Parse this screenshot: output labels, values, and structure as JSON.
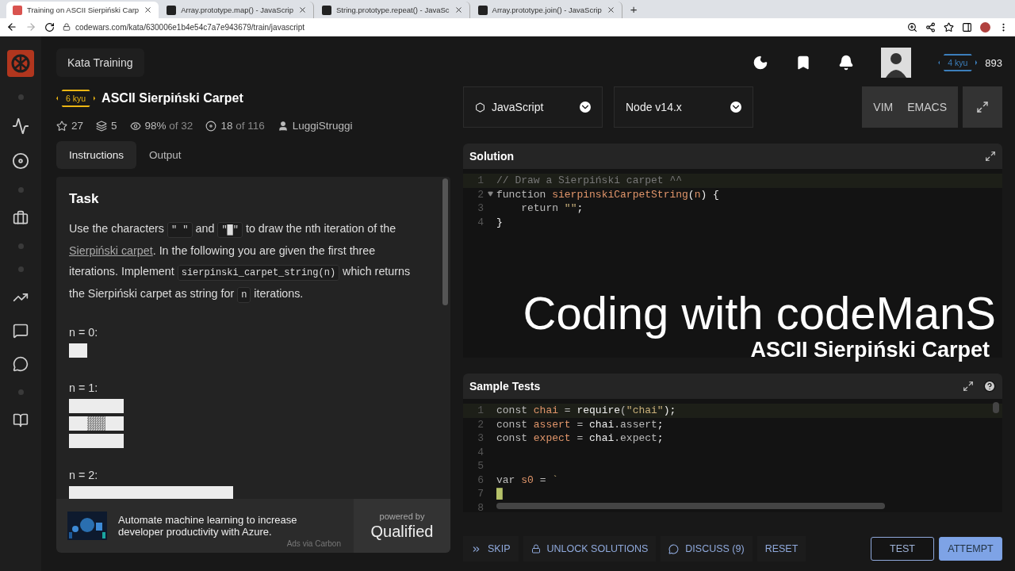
{
  "browser": {
    "tabs": [
      {
        "title": "Training on ASCII Sierpiński Carp",
        "selected": true
      },
      {
        "title": "Array.prototype.map() - JavaScrip",
        "selected": false
      },
      {
        "title": "String.prototype.repeat() - JavaSc",
        "selected": false
      },
      {
        "title": "Array.prototype.join() - JavaScrip",
        "selected": false
      }
    ],
    "new_tab": "+",
    "url": "codewars.com/kata/630006e1b4e54c7a7e943679/train/javascript"
  },
  "header": {
    "title": "Kata Training",
    "rank": "4 kyu",
    "honor": "893"
  },
  "kata": {
    "rank": "6 kyu",
    "title": "ASCII Sierpiński Carpet",
    "stars": "27",
    "collections": "5",
    "satisfaction": "98%",
    "satisfaction_of": "of 32",
    "completed": "18",
    "completed_of": "of 116",
    "author": "LuggiStruggi"
  },
  "tabs": [
    {
      "label": "Instructions",
      "selected": true
    },
    {
      "label": "Output",
      "selected": false
    }
  ],
  "description": {
    "heading": "Task",
    "paragraph": [
      {
        "kind": "text",
        "text": "Use the characters "
      },
      {
        "kind": "code",
        "text": "\" \""
      },
      {
        "kind": "text",
        "text": " and "
      },
      {
        "kind": "code",
        "text": "\"█\""
      },
      {
        "kind": "text",
        "text": " to draw the nth iteration of the "
      },
      {
        "kind": "link",
        "text": "Sierpiński carpet"
      },
      {
        "kind": "text",
        "text": ". In the following you are given the first three iterations. Implement "
      },
      {
        "kind": "code",
        "text": "sierpinski_carpet_string(n)"
      },
      {
        "kind": "text",
        "text": " which returns the Sierpiński carpet as string for "
      },
      {
        "kind": "code",
        "text": "n"
      },
      {
        "kind": "text",
        "text": " iterations."
      }
    ],
    "examples": [
      {
        "label": "n = 0:"
      },
      {
        "label": "n = 1:"
      },
      {
        "label": "n = 2:"
      }
    ]
  },
  "ad": {
    "text": "Automate machine learning to increase developer productivity with Azure.",
    "source": "Ads via Carbon",
    "powered_by": "powered by",
    "brand": "Qualified"
  },
  "editor": {
    "language": "JavaScript",
    "version": "Node v14.x",
    "modes": [
      "VIM",
      "EMACS"
    ],
    "solution": {
      "title": "Solution",
      "lines": [
        {
          "number": "1",
          "fold": false,
          "tokens": [
            {
              "kind": "comment",
              "text": "// Draw a Sierpiński carpet ^^"
            }
          ]
        },
        {
          "number": "2",
          "fold": true,
          "tokens": [
            {
              "kind": "keyword",
              "text": "function "
            },
            {
              "kind": "name",
              "text": "sierpinskiCarpetString"
            },
            {
              "kind": "plain",
              "text": "("
            },
            {
              "kind": "name",
              "text": "n"
            },
            {
              "kind": "plain",
              "text": ") {"
            }
          ]
        },
        {
          "number": "3",
          "fold": false,
          "tokens": [
            {
              "kind": "keyword",
              "text": "    return "
            },
            {
              "kind": "string",
              "text": "\"\""
            },
            {
              "kind": "plain",
              "text": ";"
            }
          ]
        },
        {
          "number": "4",
          "fold": false,
          "tokens": [
            {
              "kind": "plain",
              "text": "}"
            }
          ]
        }
      ]
    },
    "tests": {
      "title": "Sample Tests",
      "lines": [
        {
          "number": "1",
          "fold": false,
          "tokens": [
            {
              "kind": "keyword",
              "text": "const "
            },
            {
              "kind": "name",
              "text": "chai"
            },
            {
              "kind": "keyword",
              "text": " = "
            },
            {
              "kind": "plain",
              "text": "require"
            },
            {
              "kind": "keyword",
              "text": "("
            },
            {
              "kind": "string",
              "text": "\"chai\""
            },
            {
              "kind": "plain",
              "text": ");"
            }
          ]
        },
        {
          "number": "2",
          "fold": false,
          "tokens": [
            {
              "kind": "keyword",
              "text": "const "
            },
            {
              "kind": "name",
              "text": "assert"
            },
            {
              "kind": "keyword",
              "text": " = "
            },
            {
              "kind": "plain",
              "text": "chai"
            },
            {
              "kind": "keyword",
              "text": ".assert"
            },
            {
              "kind": "plain",
              "text": ";"
            }
          ]
        },
        {
          "number": "3",
          "fold": false,
          "tokens": [
            {
              "kind": "keyword",
              "text": "const "
            },
            {
              "kind": "name",
              "text": "expect"
            },
            {
              "kind": "keyword",
              "text": " = "
            },
            {
              "kind": "plain",
              "text": "chai"
            },
            {
              "kind": "keyword",
              "text": ".expect"
            },
            {
              "kind": "plain",
              "text": ";"
            }
          ]
        },
        {
          "number": "4",
          "fold": false
        },
        {
          "number": "5",
          "fold": false
        },
        {
          "number": "6",
          "fold": false,
          "tokens": [
            {
              "kind": "keyword",
              "text": "var "
            },
            {
              "kind": "name",
              "text": "s0"
            },
            {
              "kind": "keyword",
              "text": " = "
            },
            {
              "kind": "string",
              "text": "`"
            }
          ]
        },
        {
          "number": "7",
          "fold": false,
          "tokens": [
            {
              "kind": "block",
              "text": "█"
            }
          ]
        },
        {
          "number": "8",
          "fold": false
        }
      ]
    }
  },
  "actions": [
    {
      "kind": "skip",
      "label": "SKIP"
    },
    {
      "kind": "lock",
      "label": "UNLOCK SOLUTIONS"
    },
    {
      "kind": "discuss",
      "label": "DISCUSS (9)"
    },
    {
      "kind": "plain",
      "label": "RESET"
    }
  ],
  "submit": [
    {
      "label": "TEST",
      "primary": false
    },
    {
      "label": "ATTEMPT",
      "primary": true
    }
  ],
  "overlay": {
    "title": "Coding with codeManS",
    "subtitle": "ASCII Sierpiński Carpet"
  }
}
